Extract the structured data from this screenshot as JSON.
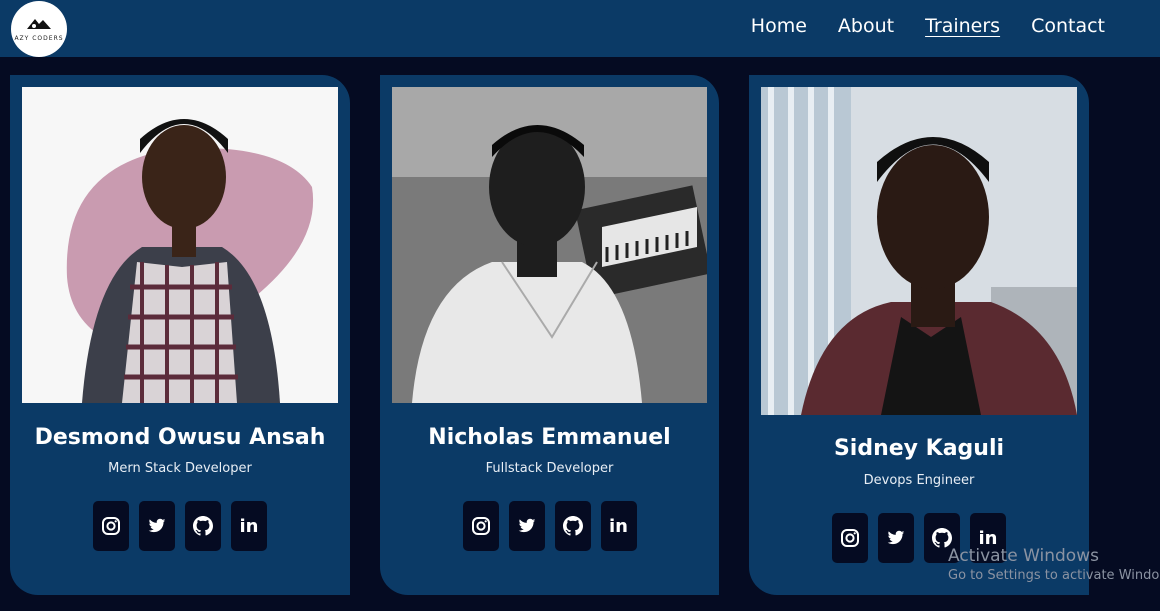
{
  "navbar": {
    "logo_text": "AZY CODERS",
    "links": [
      {
        "label": "Home",
        "active": false
      },
      {
        "label": "About",
        "active": false
      },
      {
        "label": "Trainers",
        "active": true
      },
      {
        "label": "Contact",
        "active": false
      }
    ]
  },
  "trainers": [
    {
      "name": "Desmond Owusu Ansah",
      "role": "Mern Stack Developer",
      "photo_bg": "light backdrop with pink blob"
    },
    {
      "name": "Nicholas Emmanuel",
      "role": "Fullstack Developer",
      "photo_bg": "grayscale studio with keyboard"
    },
    {
      "name": "Sidney Kaguli",
      "role": "Devops Engineer",
      "photo_bg": "office window"
    }
  ],
  "socials": [
    "instagram-icon",
    "twitter-icon",
    "github-icon",
    "linkedin-icon"
  ],
  "watermark": {
    "title": "Activate Windows",
    "subtitle": "Go to Settings to activate Windows."
  },
  "colors": {
    "page_bg": "#050b22",
    "navbar_bg": "#0b3a66",
    "card_bg": "#0b3a66",
    "button_bg": "#050b22"
  }
}
